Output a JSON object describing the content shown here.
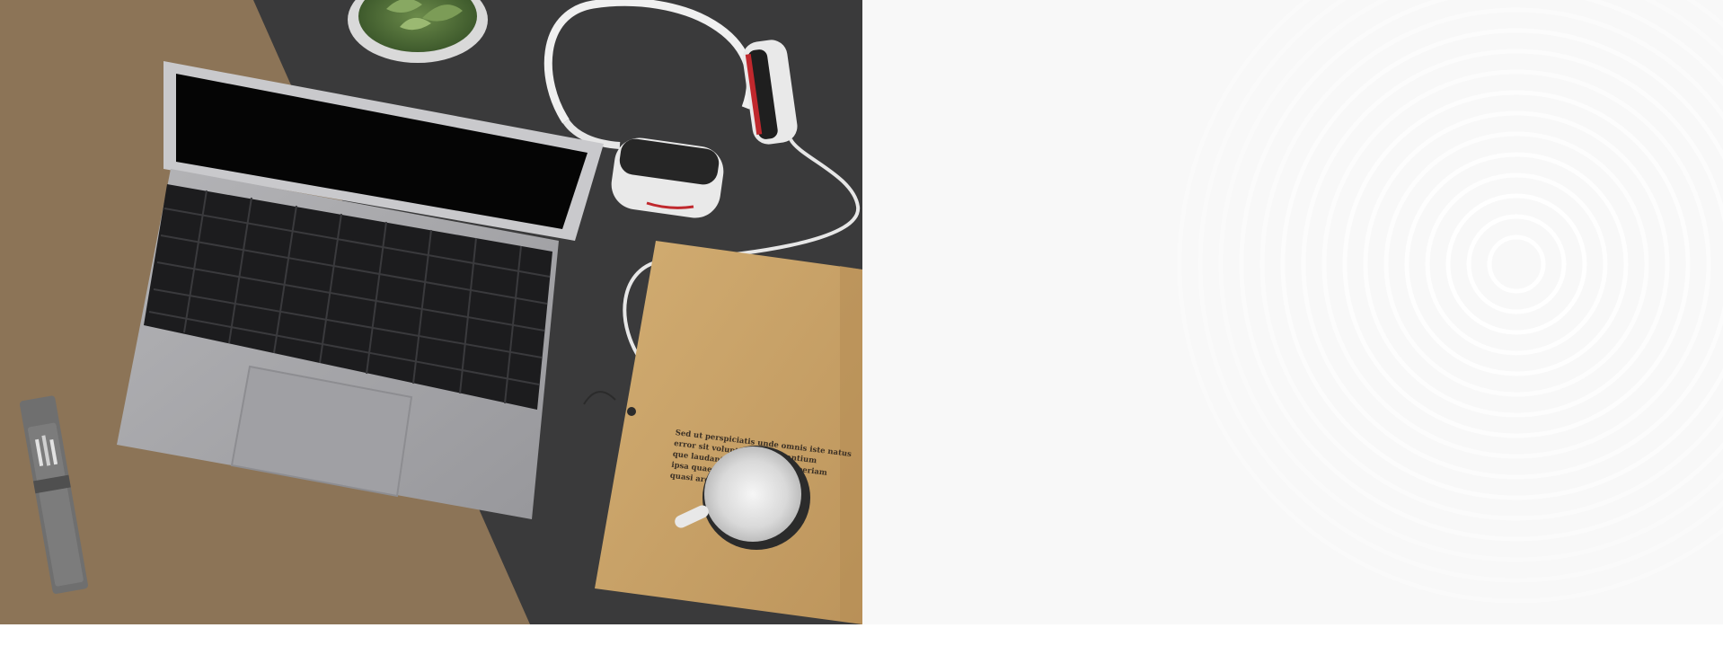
{
  "hero": {
    "photo": {
      "subject": "desk-flatlay",
      "colors": {
        "desk_tan": "#8c7457",
        "desk_dark": "#3a3a3b",
        "laptop": "#a8a8ab",
        "notebook": "#c9a46b"
      },
      "notebook_text": [
        "Sed ut perspiciatis unde omnis iste natus",
        "error sit voluptatem accusantium",
        "que laudantium, totam rem aperiam",
        "ipsa quae ab illo inventore",
        "quasi architecto beatae vitae"
      ]
    },
    "pattern": {
      "type": "concentric-rings",
      "background": "#f8f8f8",
      "ring_color": "#ffffff"
    }
  }
}
